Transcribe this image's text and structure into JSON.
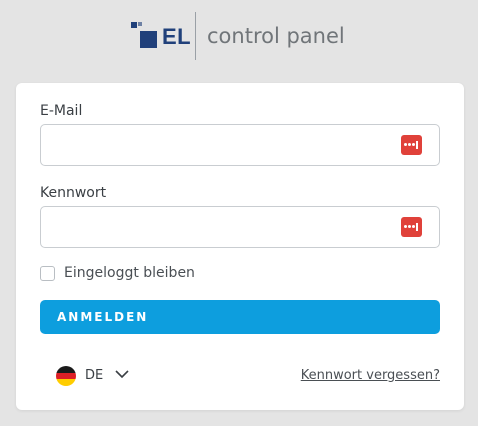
{
  "brand": {
    "logo_abbrev": "EL",
    "product_name": "control panel",
    "logo_color": "#20407a"
  },
  "form": {
    "email_label": "E-Mail",
    "email_value": "",
    "email_icon": "password-manager-icon",
    "password_label": "Kennwort",
    "password_value": "",
    "password_icon": "password-manager-icon",
    "remember_label": "Eingeloggt bleiben",
    "remember_checked": false,
    "submit_label": "ANMELDEN",
    "accent_color": "#0d9ede"
  },
  "footer": {
    "language_code": "DE",
    "language_flag_icon": "germany-flag-icon",
    "language_dropdown_icon": "chevron-down-icon",
    "forgot_password_link": "Kennwort vergessen?"
  }
}
